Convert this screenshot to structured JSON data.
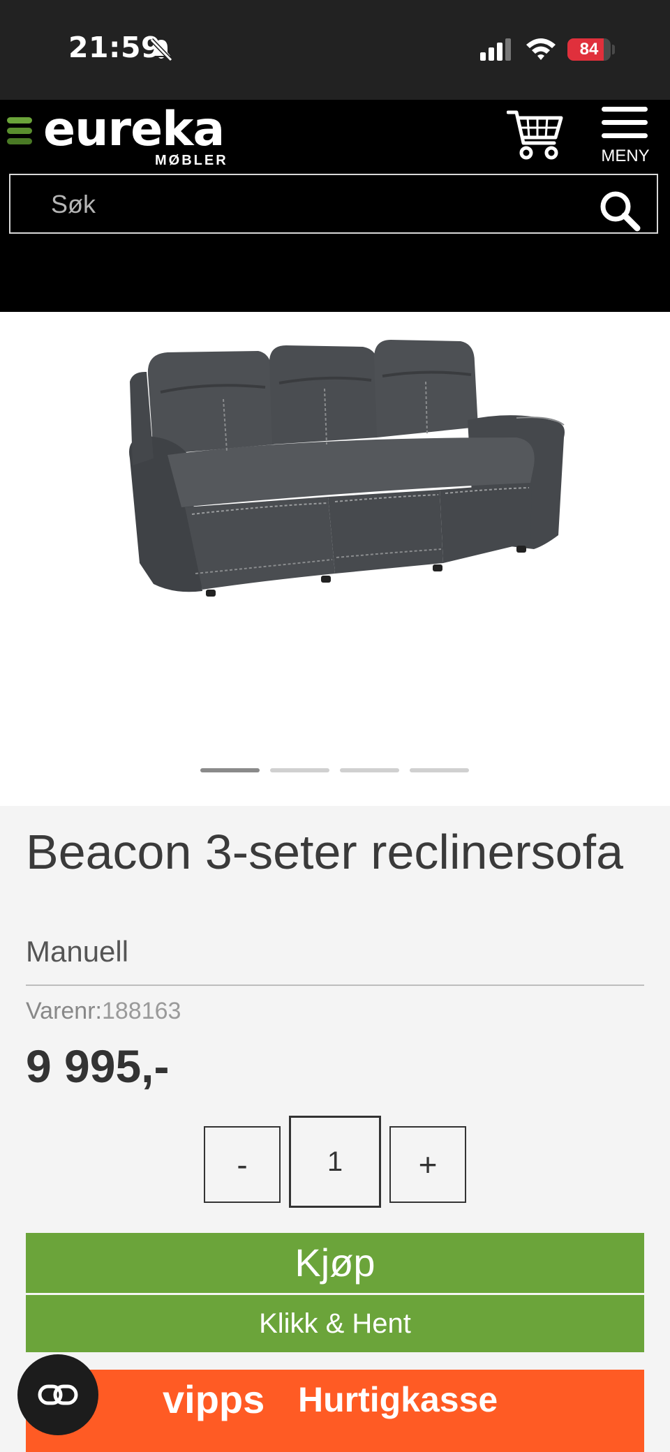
{
  "status_bar": {
    "time": "21:59",
    "battery_level": "84",
    "battery_percent": 0.84
  },
  "header": {
    "logo_text": "eureka",
    "logo_sub": "MØBLER",
    "menu_label": "MENY",
    "search_placeholder": "Søk",
    "colors": {
      "background": "#000000",
      "logo_accent_top": "#6ba43a",
      "logo_accent_bottom": "#4a7a25"
    }
  },
  "gallery": {
    "image": "sofa-photo",
    "slide_count": 4,
    "active_slide": 1
  },
  "product": {
    "title": "Beacon 3-seter reclinersofa",
    "subtitle": "Manuell",
    "sku_label": "Varenr:",
    "sku_value": "188163",
    "price": "9 995,-"
  },
  "quantity": {
    "minus_label": "-",
    "value": "1",
    "plus_label": "+"
  },
  "actions": {
    "buy_label": "Kjøp",
    "pickup_label": "Klikk & Hent",
    "vipps_logo": "vipps",
    "vipps_label": "Hurtigkasse",
    "colors": {
      "green": "#6ba43a",
      "vipps_orange": "#ff5b24"
    }
  },
  "chat": {
    "icon": "chat-link-icon"
  }
}
